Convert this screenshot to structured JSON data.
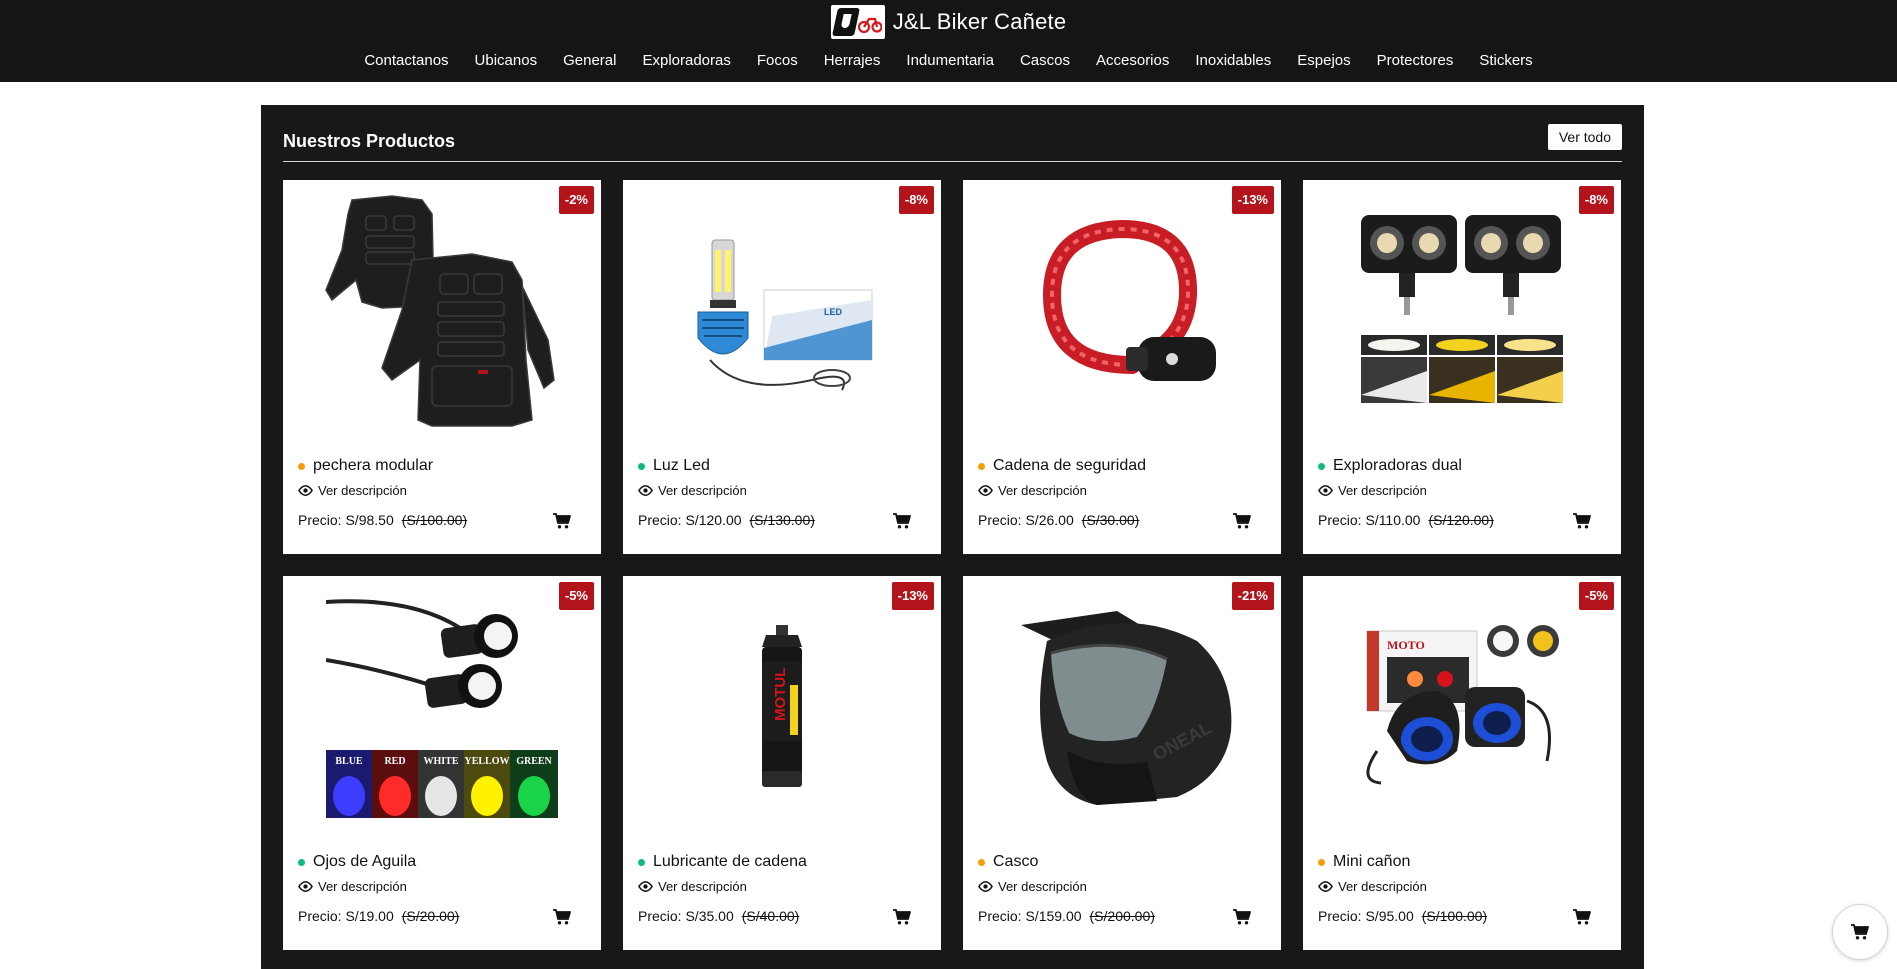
{
  "header": {
    "brand_title": "J&L Biker Cañete",
    "nav": [
      "Contactanos",
      "Ubicanos",
      "General",
      "Exploradoras",
      "Focos",
      "Herrajes",
      "Indumentaria",
      "Cascos",
      "Accesorios",
      "Inoxidables",
      "Espejos",
      "Protectores",
      "Stickers"
    ]
  },
  "section": {
    "title": "Nuestros Productos",
    "view_all": "Ver todo"
  },
  "products": [
    {
      "name": "pechera modular",
      "discount": "-2%",
      "price_label": "Precio: S/98.50",
      "old_price": "(S/100.00)",
      "desc": "Ver descripción",
      "dot_color": "#f59e0b",
      "image": "body-armor"
    },
    {
      "name": "Luz Led",
      "discount": "-8%",
      "price_label": "Precio: S/120.00",
      "old_price": "(S/130.00)",
      "desc": "Ver descripción",
      "dot_color": "#10b981",
      "image": "led-bulb"
    },
    {
      "name": "Cadena de seguridad",
      "discount": "-13%",
      "price_label": "Precio: S/26.00",
      "old_price": "(S/30.00)",
      "desc": "Ver descripción",
      "dot_color": "#f59e0b",
      "image": "cable-lock"
    },
    {
      "name": "Exploradoras dual",
      "discount": "-8%",
      "price_label": "Precio: S/110.00",
      "old_price": "(S/120.00)",
      "desc": "Ver descripción",
      "dot_color": "#10b981",
      "image": "dual-fog-lights"
    },
    {
      "name": "Ojos de Aguila",
      "discount": "-5%",
      "price_label": "Precio: S/19.00",
      "old_price": "(S/20.00)",
      "desc": "Ver descripción",
      "dot_color": "#10b981",
      "image": "eagle-eye-lights",
      "image_labels": [
        "BLUE",
        "RED",
        "WHITE",
        "YELLOW",
        "GREEN"
      ]
    },
    {
      "name": "Lubricante de cadena",
      "discount": "-13%",
      "price_label": "Precio: S/35.00",
      "old_price": "(S/40.00)",
      "desc": "Ver descripción",
      "dot_color": "#10b981",
      "image": "chain-lube-can"
    },
    {
      "name": "Casco",
      "discount": "-21%",
      "price_label": "Precio: S/159.00",
      "old_price": "(S/200.00)",
      "desc": "Ver descripción",
      "dot_color": "#f59e0b",
      "image": "helmet"
    },
    {
      "name": "Mini cañon",
      "discount": "-5%",
      "price_label": "Precio: S/95.00",
      "old_price": "(S/100.00)",
      "desc": "Ver descripción",
      "dot_color": "#f59e0b",
      "image": "mini-cannon-light"
    }
  ],
  "icons": {
    "eye": "eye-icon",
    "cart": "cart-icon",
    "floating_cart": "floating-cart-icon"
  }
}
